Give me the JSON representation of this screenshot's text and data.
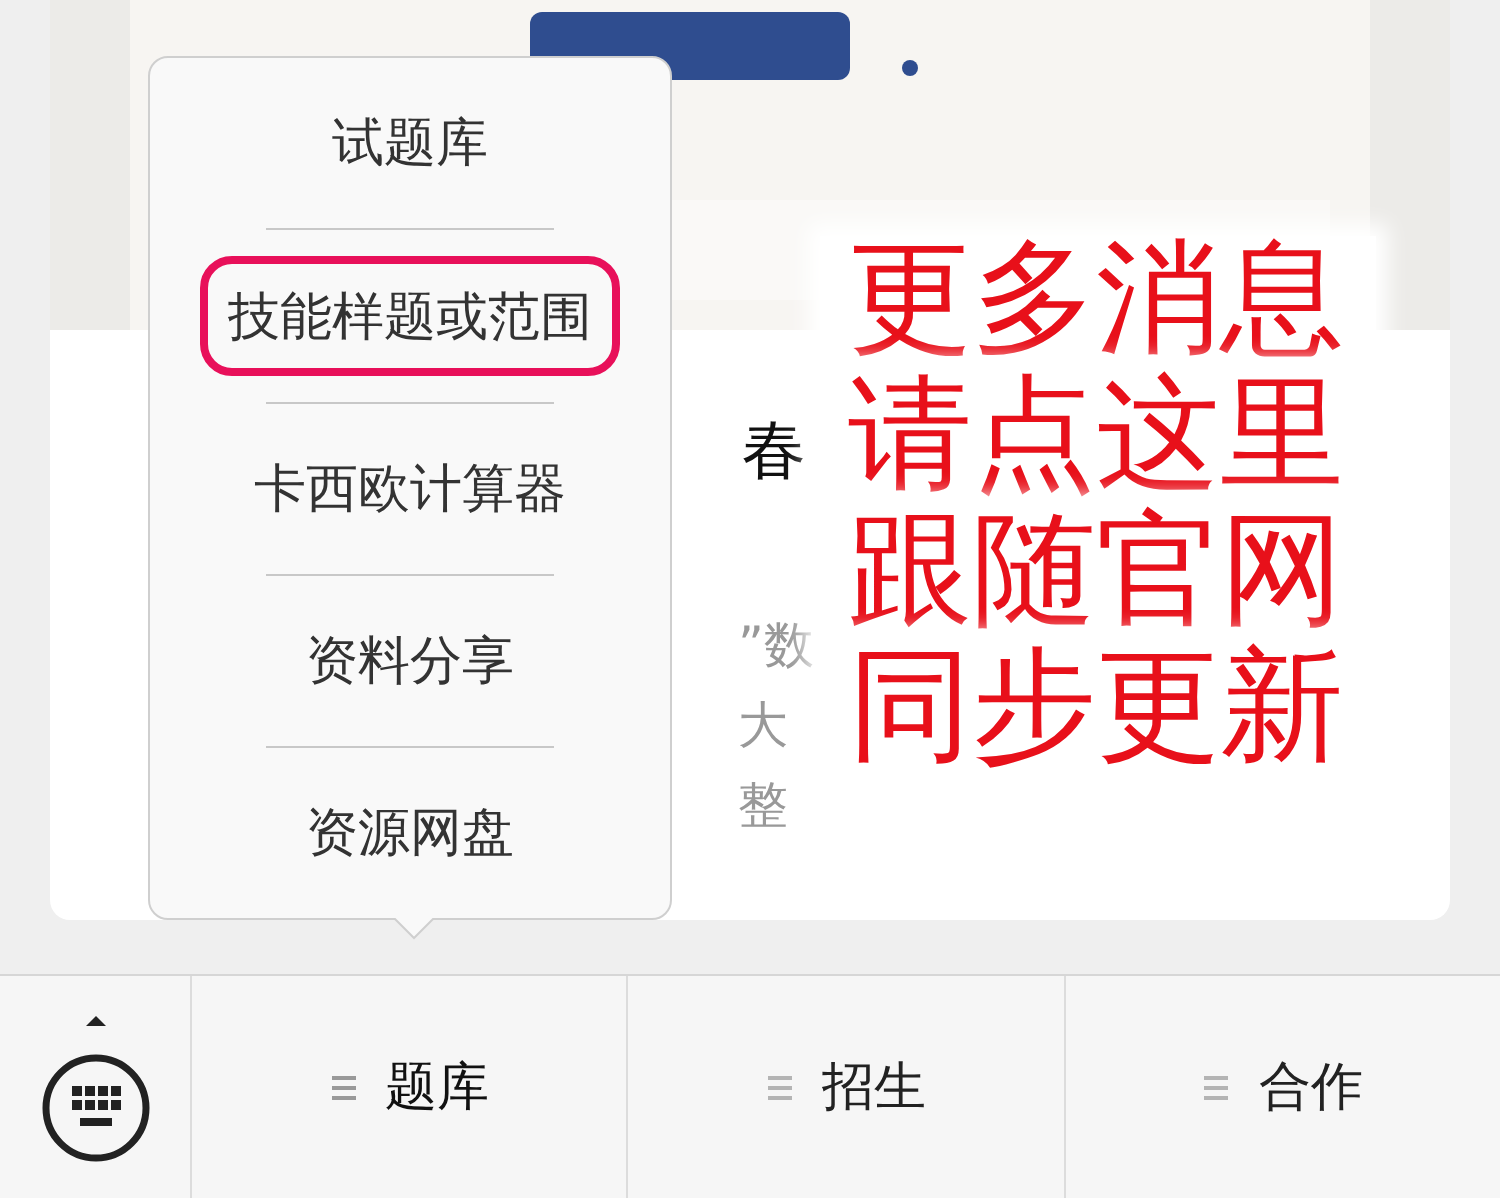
{
  "article_card": {
    "title_fragment": "春",
    "summary_fragments": [
      "”数",
      "大",
      "整"
    ]
  },
  "popup_menu": {
    "items": [
      {
        "label": "试题库",
        "circled": false
      },
      {
        "label": "技能样题或范围",
        "circled": true
      },
      {
        "label": "卡西欧计算器",
        "circled": false
      },
      {
        "label": "资料分享",
        "circled": false
      },
      {
        "label": "资源网盘",
        "circled": false
      }
    ]
  },
  "overlay_notice": {
    "lines": [
      "更多消息",
      "请点这里",
      "跟随官网",
      "同步更新"
    ]
  },
  "bottom_menu": {
    "tabs": [
      {
        "label": "题库",
        "selected": true
      },
      {
        "label": "招生",
        "selected": false
      },
      {
        "label": "合作",
        "selected": false
      }
    ]
  }
}
